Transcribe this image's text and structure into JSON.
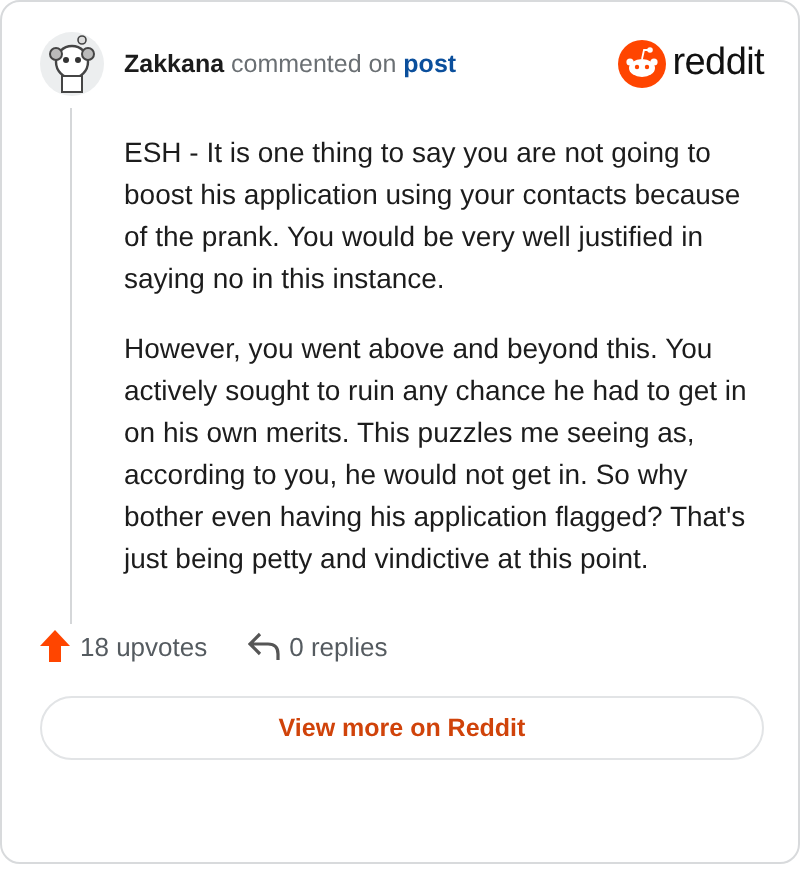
{
  "comment": {
    "author": "Zakkana",
    "action": "commented on",
    "link": "post",
    "brand": "reddit",
    "paragraphs": [
      "ESH - It is one thing to say you are not going to boost his application using your contacts because of the prank. You would be very well justified in saying no in this instance.",
      "However, you went above and beyond this. You actively sought to ruin any chance he had to get in on his own merits. This puzzles me seeing as, according to you, he would not get in. So why bother even having his application flagged? That's just being petty and vindictive at this point."
    ],
    "upvotes": "18 upvotes",
    "replies": "0 replies"
  },
  "button": "View more on Reddit"
}
